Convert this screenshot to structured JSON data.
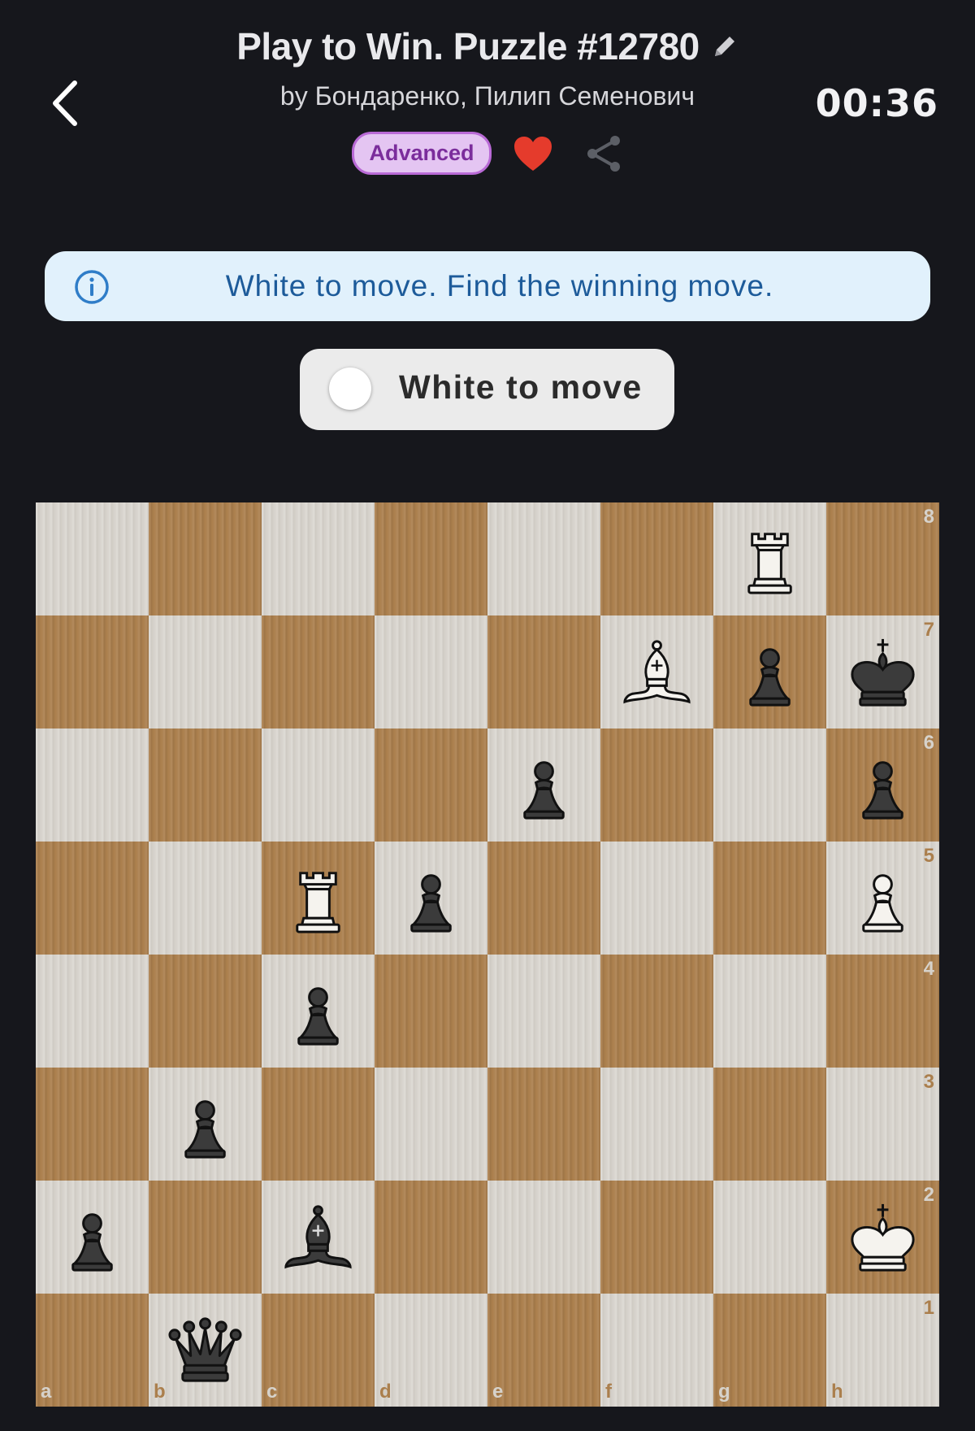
{
  "header": {
    "title": "Play to Win. Puzzle #12780",
    "author": "by Бондаренко, Пилип Семенович",
    "timer": "00:36",
    "difficulty": "Advanced",
    "favorited": true
  },
  "banner": {
    "text": "White to move. Find the winning move."
  },
  "turn_indicator": {
    "text": "White to move"
  },
  "colors": {
    "background": "#16171c",
    "banner_bg": "#e1f1fc",
    "banner_text": "#1d5b9a",
    "badge_bg": "#e4c5f2",
    "badge_text": "#7b2d9c",
    "heart": "#e53b2c",
    "light_square": "#d6d2cb",
    "dark_square": "#ab7f4d"
  },
  "board": {
    "files": [
      "a",
      "b",
      "c",
      "d",
      "e",
      "f",
      "g",
      "h"
    ],
    "ranks": [
      "8",
      "7",
      "6",
      "5",
      "4",
      "3",
      "2",
      "1"
    ],
    "orientation": "white",
    "pieces": [
      {
        "square": "g8",
        "color": "white",
        "type": "rook"
      },
      {
        "square": "f7",
        "color": "white",
        "type": "bishop"
      },
      {
        "square": "g7",
        "color": "black",
        "type": "pawn"
      },
      {
        "square": "h7",
        "color": "black",
        "type": "king"
      },
      {
        "square": "e6",
        "color": "black",
        "type": "pawn"
      },
      {
        "square": "h6",
        "color": "black",
        "type": "pawn"
      },
      {
        "square": "c5",
        "color": "white",
        "type": "rook"
      },
      {
        "square": "d5",
        "color": "black",
        "type": "pawn"
      },
      {
        "square": "h5",
        "color": "white",
        "type": "pawn"
      },
      {
        "square": "c4",
        "color": "black",
        "type": "pawn"
      },
      {
        "square": "b3",
        "color": "black",
        "type": "pawn"
      },
      {
        "square": "a2",
        "color": "black",
        "type": "pawn"
      },
      {
        "square": "c2",
        "color": "black",
        "type": "bishop"
      },
      {
        "square": "h2",
        "color": "white",
        "type": "king"
      },
      {
        "square": "b1",
        "color": "black",
        "type": "queen"
      }
    ]
  }
}
